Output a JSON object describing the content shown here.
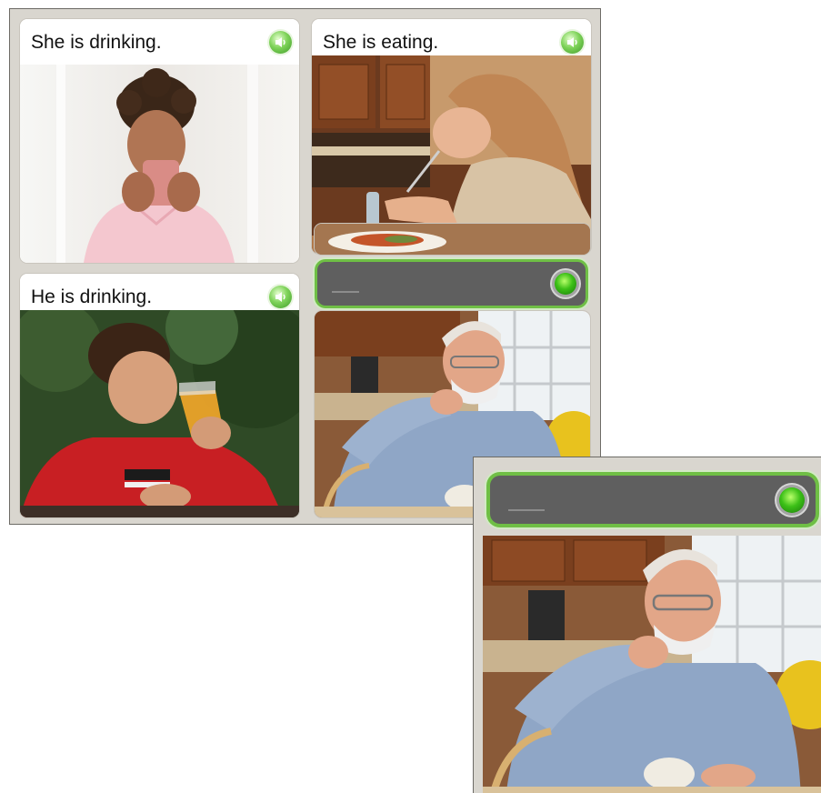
{
  "cards": [
    {
      "caption": "She is drinking.",
      "icon": "speaker-icon"
    },
    {
      "caption": "She is eating.",
      "icon": "speaker-icon"
    },
    {
      "caption": "He is drinking.",
      "icon": "speaker-icon"
    }
  ],
  "answer": {
    "value": "",
    "status_icon": "green-indicator-icon"
  },
  "colors": {
    "panel_background": "#d9d6cf",
    "answer_bar": "#5f5f5f",
    "answer_border": "#6fbf45",
    "speaker_green": "#5cc03a"
  }
}
